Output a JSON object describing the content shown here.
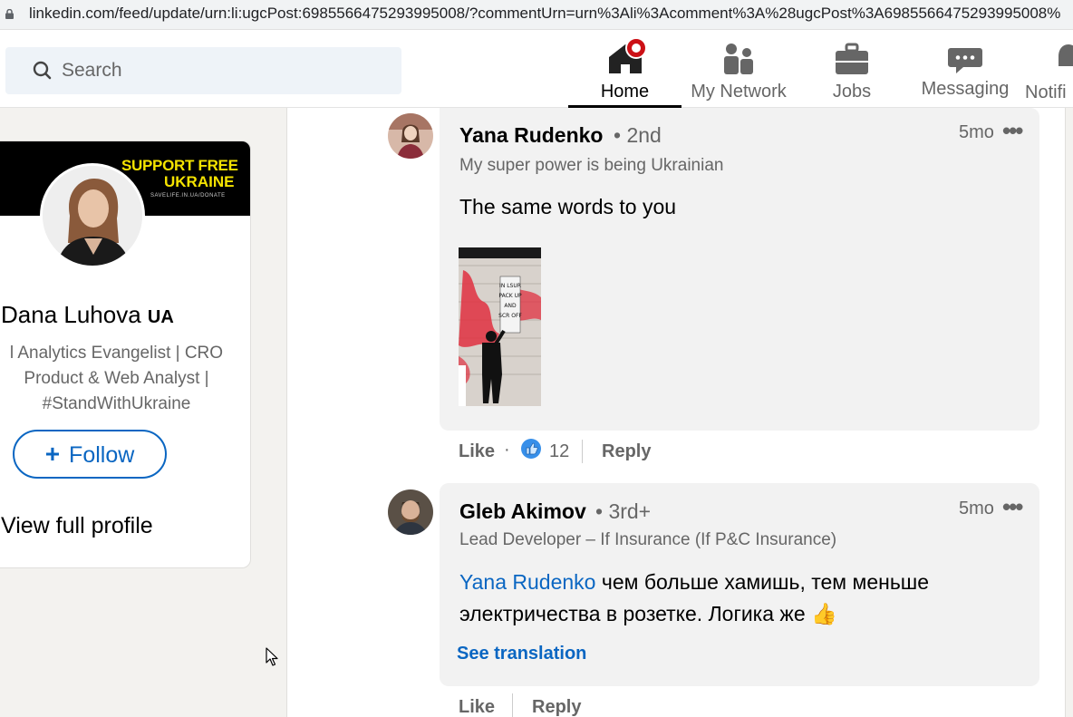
{
  "browser": {
    "url": "linkedin.com/feed/update/urn:li:ugcPost:6985566475293995008/?commentUrn=urn%3Ali%3Acomment%3A%28ugcPost%3A6985566475293995008%"
  },
  "nav": {
    "search_placeholder": "Search",
    "items": [
      {
        "label": "Home",
        "icon": "home-icon"
      },
      {
        "label": "My Network",
        "icon": "people-icon"
      },
      {
        "label": "Jobs",
        "icon": "briefcase-icon"
      },
      {
        "label": "Messaging",
        "icon": "chat-icon"
      },
      {
        "label": "Notifi",
        "icon": "bell-icon"
      }
    ]
  },
  "profile": {
    "banner_line1": "SUPPORT FREE",
    "banner_line2": "UKRAINE",
    "banner_url": "SAVELIFE.IN.UA/DONATE",
    "name": "Dana Luhova",
    "flag_text": "UA",
    "headline": [
      "l Analytics Evangelist | CRO",
      "Product & Web Analyst |",
      "#StandWithUkraine"
    ],
    "follow_label": "Follow",
    "view_profile": "View full profile"
  },
  "comments": [
    {
      "author": "Yana Rudenko",
      "degree": "• 2nd",
      "headline": "My super power is being Ukrainian",
      "time": "5mo",
      "text": "The same words to you",
      "image_sign": [
        "IN LSUR",
        "PACK UP",
        "AND",
        "SCR OFF"
      ],
      "actions": {
        "like": "Like",
        "dot": "·",
        "like_count": "12",
        "reply": "Reply"
      }
    },
    {
      "author": "Gleb Akimov",
      "degree": "• 3rd+",
      "headline": "Lead Developer – If Insurance (If P&C Insurance)",
      "time": "5mo",
      "mention": "Yana Rudenko",
      "text_line1": " чем больше хамишь, тем меньше",
      "text_line2": "электричества в розетке. Логика же 👍",
      "see_translation": "See translation",
      "actions": {
        "like": "Like",
        "reply": "Reply"
      }
    }
  ],
  "colors": {
    "brand_blue": "#0a66c2",
    "notification_red": "#cc1016",
    "banner_yellow": "#f5e300"
  }
}
